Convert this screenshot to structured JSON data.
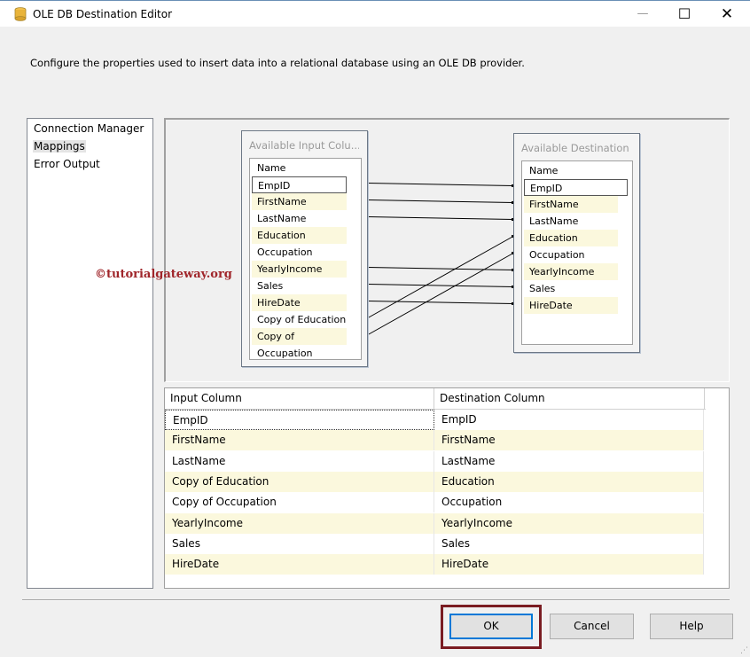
{
  "window": {
    "title": "OLE DB Destination Editor",
    "icon": "database-cylinder-icon",
    "min_glyph": "—",
    "max_glyph": "☐",
    "close_glyph": "✕"
  },
  "description": "Configure the properties used to insert data into a relational database using an OLE DB provider.",
  "nav": {
    "items": [
      {
        "label": "Connection Manager",
        "selected": false
      },
      {
        "label": "Mappings",
        "selected": true
      },
      {
        "label": "Error Output",
        "selected": false
      }
    ]
  },
  "watermark": "©tutorialgateway.org",
  "input_box": {
    "title": "Available Input Colu...",
    "columns": [
      "Name",
      "EmpID",
      "FirstName",
      "LastName",
      "Education",
      "Occupation",
      "YearlyIncome",
      "Sales",
      "HireDate",
      "Copy of Education",
      "Copy of Occupation"
    ]
  },
  "dest_box": {
    "title": "Available Destination ...",
    "columns": [
      "Name",
      "EmpID",
      "FirstName",
      "LastName",
      "Education",
      "Occupation",
      "YearlyIncome",
      "Sales",
      "HireDate"
    ]
  },
  "links": [
    {
      "from": "EmpID",
      "to": "EmpID"
    },
    {
      "from": "FirstName",
      "to": "FirstName"
    },
    {
      "from": "LastName",
      "to": "LastName"
    },
    {
      "from": "YearlyIncome",
      "to": "YearlyIncome"
    },
    {
      "from": "Sales",
      "to": "Sales"
    },
    {
      "from": "HireDate",
      "to": "HireDate"
    },
    {
      "from": "Copy of Education",
      "to": "Education"
    },
    {
      "from": "Copy of Occupation",
      "to": "Occupation"
    }
  ],
  "grid": {
    "headers": [
      "Input Column",
      "Destination Column"
    ],
    "rows": [
      [
        "EmpID",
        "EmpID"
      ],
      [
        "FirstName",
        "FirstName"
      ],
      [
        "LastName",
        "LastName"
      ],
      [
        "Copy of Education",
        "Education"
      ],
      [
        "Copy of Occupation",
        "Occupation"
      ],
      [
        "YearlyIncome",
        "YearlyIncome"
      ],
      [
        "Sales",
        "Sales"
      ],
      [
        "HireDate",
        "HireDate"
      ]
    ]
  },
  "buttons": {
    "ok": "OK",
    "cancel": "Cancel",
    "help": "Help"
  },
  "colors": {
    "row_highlight": "#fbf8dd",
    "ok_outline": "#7a1c22",
    "accent": "#0078d7"
  }
}
